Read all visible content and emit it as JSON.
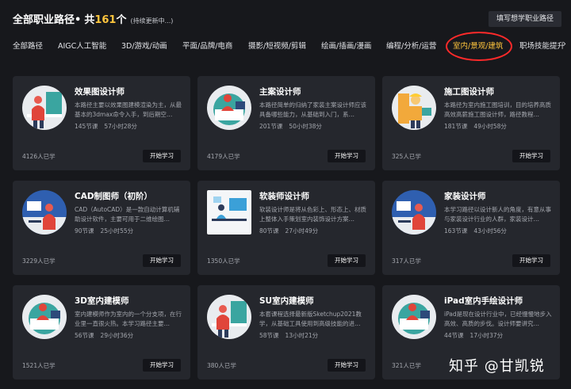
{
  "header": {
    "title": "全部职业路径•",
    "count_prefix": "共",
    "count": "161",
    "count_unit": "个",
    "note": "(持续更新中...)",
    "button": "填写想学职业路径"
  },
  "nav": {
    "tabs": [
      {
        "label": "全部路径",
        "active": false
      },
      {
        "label": "AIGC人工智能",
        "active": false
      },
      {
        "label": "3D/游戏/动画",
        "active": false
      },
      {
        "label": "平面/品牌/电商",
        "active": false
      },
      {
        "label": "摄影/短视频/剪辑",
        "active": false
      },
      {
        "label": "绘画/插画/漫画",
        "active": false
      },
      {
        "label": "编程/分析/运营",
        "active": false
      },
      {
        "label": "室内/景观/建筑",
        "active": true
      },
      {
        "label": "职场技能提升",
        "active": false
      }
    ],
    "more_arrow": "›"
  },
  "cards": [
    {
      "title": "效果图设计师",
      "desc": "本路径主要以效果图建模渲染为主，从最基本的3dmax命令入手，到后期空…",
      "lessons": "145节课",
      "duration": "57小时28分",
      "learners": "4126人已学",
      "button": "开始学习",
      "thumb": "round-red"
    },
    {
      "title": "主案设计师",
      "desc": "本路径简单的归纳了家装主案设计师应该具备哪些能力，从基础到入门，系…",
      "lessons": "201节课",
      "duration": "50小时38分",
      "learners": "4179人已学",
      "button": "开始学习",
      "thumb": "round-teal"
    },
    {
      "title": "施工图设计师",
      "desc": "本路径为室内施工图培训，目的培养高质高效高薪施工图设计师，路径教程…",
      "lessons": "181节课",
      "duration": "49小时58分",
      "learners": "325人已学",
      "button": "开始学习",
      "thumb": "round-worker"
    },
    {
      "title": "CAD制图师（初阶）",
      "desc": "CAD（AutoCAD）是一款自动计算机辅助设计软件，主要可用于二维绘图…",
      "lessons": "90节课",
      "duration": "25小时55分",
      "learners": "3229人已学",
      "button": "开始学习",
      "thumb": "round-blue"
    },
    {
      "title": "软装师设计师",
      "desc": "软装设计师是将从色彩上、形态上、材质上整体入手策划室内装饰设计方案…",
      "lessons": "80节课",
      "duration": "27小时49分",
      "learners": "1350人已学",
      "button": "开始学习",
      "thumb": "square-light"
    },
    {
      "title": "家装设计师",
      "desc": "本学习路径以设计新人的角度，有意从事与家装设计行业的人群，家装设计…",
      "lessons": "163节课",
      "duration": "43小时56分",
      "learners": "317人已学",
      "button": "开始学习",
      "thumb": "round-blue"
    },
    {
      "title": "3D室内建模师",
      "desc": "室内建模师作为室内的一个分支项，在行业里一直很火热。本学习路径主要…",
      "lessons": "56节课",
      "duration": "29小时36分",
      "learners": "1521人已学",
      "button": "开始学习",
      "thumb": "round-teal"
    },
    {
      "title": "SU室内建模师",
      "desc": "本套课程选择最新版Sketchup2021教学，从基础工具使用到高级技能的进…",
      "lessons": "58节课",
      "duration": "13小时21分",
      "learners": "380人已学",
      "button": "开始学习",
      "thumb": "round-red"
    },
    {
      "title": "iPad室内手绘设计师",
      "desc": "iPad是现在设计行业中，已经慢慢地步入高效、高质的步伐。设计师要讲究…",
      "lessons": "44节课",
      "duration": "17小时37分",
      "learners": "321人已学",
      "button": "开始学习",
      "thumb": "round-teal"
    }
  ],
  "watermark": "知乎 @甘凯锐"
}
